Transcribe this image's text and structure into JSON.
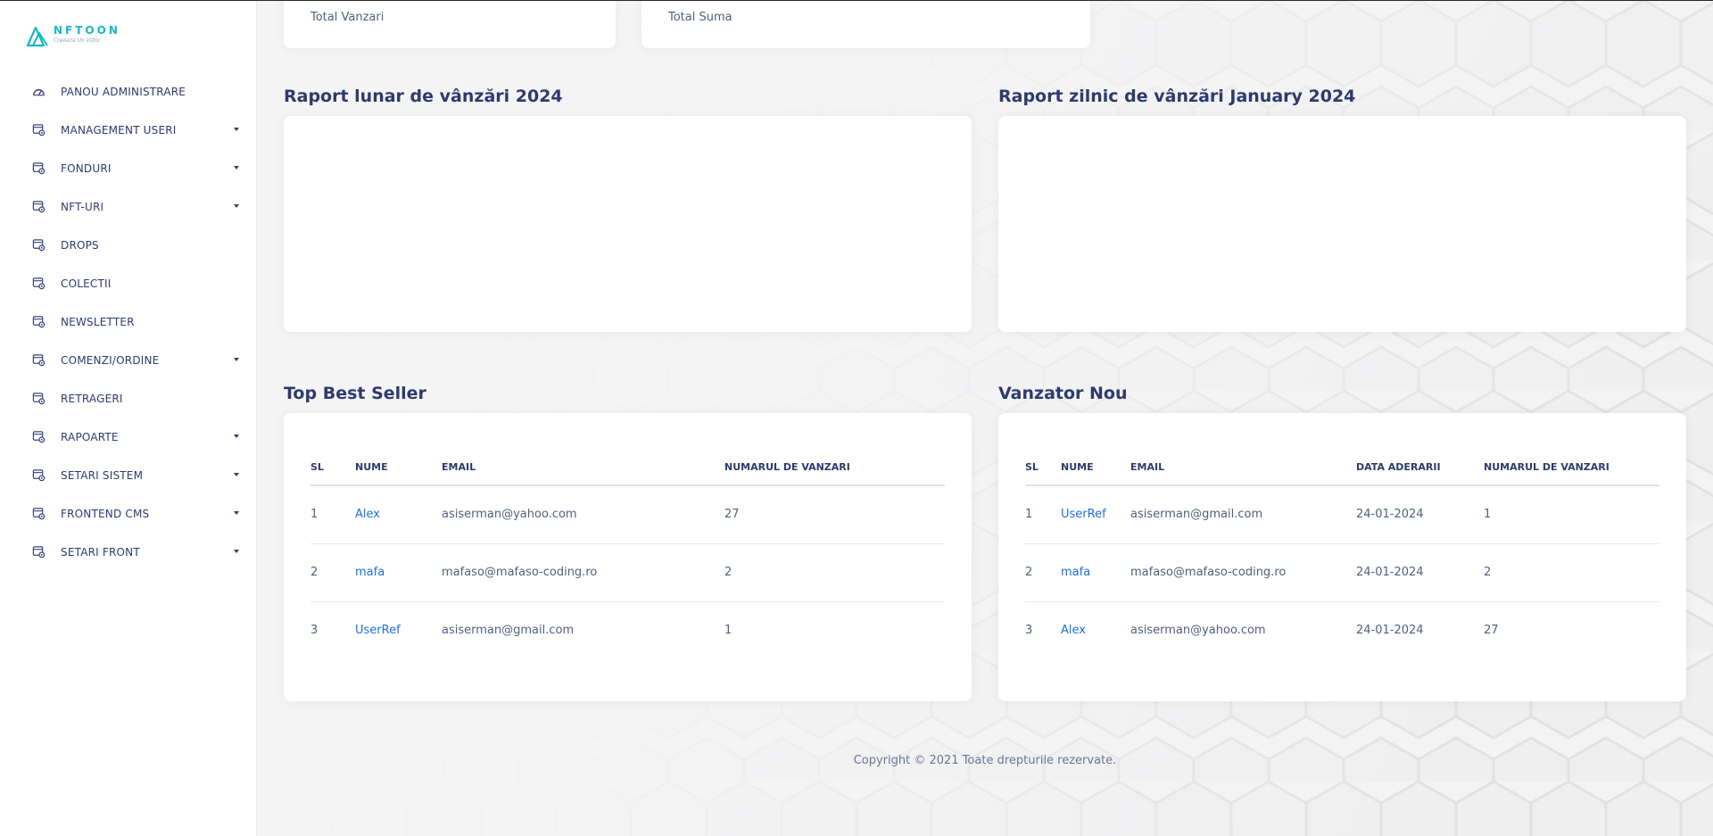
{
  "brand": {
    "name": "NFTOON",
    "tagline": "Creeaza Un Viitor",
    "accent": "#19b6c9"
  },
  "sidebar": {
    "items": [
      {
        "label": "PANOU ADMINISTRARE",
        "icon": "dashboard-icon",
        "has_caret": false
      },
      {
        "label": "MANAGEMENT USERI",
        "icon": "module-icon",
        "has_caret": true
      },
      {
        "label": "FONDURI",
        "icon": "module-icon",
        "has_caret": true
      },
      {
        "label": "NFT-URI",
        "icon": "module-icon",
        "has_caret": true
      },
      {
        "label": "DROPS",
        "icon": "module-icon",
        "has_caret": false
      },
      {
        "label": "COLECTII",
        "icon": "module-icon",
        "has_caret": false
      },
      {
        "label": "NEWSLETTER",
        "icon": "module-icon",
        "has_caret": false
      },
      {
        "label": "COMENZI/ORDINE",
        "icon": "module-icon",
        "has_caret": true
      },
      {
        "label": "RETRAGERI",
        "icon": "module-icon",
        "has_caret": false
      },
      {
        "label": "RAPOARTE",
        "icon": "module-icon",
        "has_caret": true
      },
      {
        "label": "SETARI SISTEM",
        "icon": "module-icon",
        "has_caret": true
      },
      {
        "label": "FRONTEND CMS",
        "icon": "module-icon",
        "has_caret": true
      },
      {
        "label": "SETARI FRONT",
        "icon": "module-icon",
        "has_caret": true
      }
    ]
  },
  "stats": {
    "total_sales_label": "Total Vanzari",
    "total_sum_label": "Total Suma"
  },
  "charts": {
    "monthly_title": "Raport lunar de vânzări 2024",
    "daily_title": "Raport zilnic de vânzări January 2024"
  },
  "top_sellers": {
    "title": "Top Best Seller",
    "columns": [
      "SL",
      "NUME",
      "EMAIL",
      "NUMARUL DE VANZARI"
    ],
    "rows": [
      {
        "sl": "1",
        "name": "Alex",
        "email": "asiserman@yahoo.com",
        "sales": "27"
      },
      {
        "sl": "2",
        "name": "mafa",
        "email": "mafaso@mafaso-coding.ro",
        "sales": "2"
      },
      {
        "sl": "3",
        "name": "UserRef",
        "email": "asiserman@gmail.com",
        "sales": "1"
      }
    ]
  },
  "new_sellers": {
    "title": "Vanzator Nou",
    "columns": [
      "SL",
      "NUME",
      "EMAIL",
      "DATA ADERARII",
      "NUMARUL DE VANZARI"
    ],
    "rows": [
      {
        "sl": "1",
        "name": "UserRef",
        "email": "asiserman@gmail.com",
        "date": "24-01-2024",
        "sales": "1"
      },
      {
        "sl": "2",
        "name": "mafa",
        "email": "mafaso@mafaso-coding.ro",
        "date": "24-01-2024",
        "sales": "2"
      },
      {
        "sl": "3",
        "name": "Alex",
        "email": "asiserman@yahoo.com",
        "date": "24-01-2024",
        "sales": "27"
      }
    ]
  },
  "footer": {
    "text": "Copyright © 2021 Toate drepturile rezervate."
  }
}
